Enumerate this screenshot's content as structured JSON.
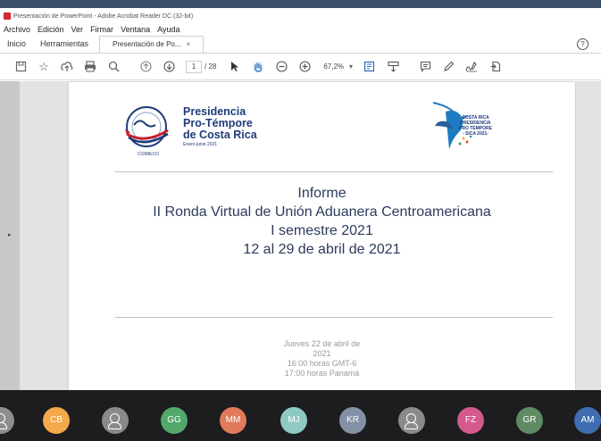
{
  "window": {
    "title": "Presentación de PowerPoint - Adobe Acrobat Reader DC (32-bit)"
  },
  "menu": [
    "Archivo",
    "Edición",
    "Ver",
    "Firmar",
    "Ventana",
    "Ayuda"
  ],
  "tabs": {
    "home": "Inicio",
    "tools": "Herramientas",
    "document": "Presentación de Po...",
    "close": "×"
  },
  "help": "?",
  "toolbar": {
    "page_current": "1",
    "page_total": "/ 28",
    "zoom": "67,2%",
    "dropdown": "▾"
  },
  "document": {
    "logo_left_lines": [
      "Presidencia",
      "Pro-Témpore",
      "de Costa Rica"
    ],
    "logo_left_sub": "Enero-junio 2021",
    "logo_left_badge": "COMIECO",
    "logo_right_lines": [
      "COSTA RICA",
      "PRESIDENCIA",
      "PRO TEMPORE",
      "- SICA 2021-"
    ],
    "title_lines": [
      "Informe",
      "II Ronda Virtual de Unión Aduanera Centroamericana",
      "I semestre 2021",
      "12 al 29 de abril de 2021"
    ],
    "meta_lines": [
      "Jueves 22 de abril de",
      "2021",
      "16:00 horas GMT-6",
      "17:00 horas Panamá"
    ]
  },
  "participants": [
    {
      "initials": "",
      "color": "#8e8e8e",
      "generic": true
    },
    {
      "initials": "CB",
      "color": "#f4a94a"
    },
    {
      "initials": "",
      "color": "#8a8a8a",
      "generic": true
    },
    {
      "initials": "GG",
      "color": "#51a86a"
    },
    {
      "initials": "MM",
      "color": "#e07a5a"
    },
    {
      "initials": "MJ",
      "color": "#8fc9c3"
    },
    {
      "initials": "KR",
      "color": "#8391a6"
    },
    {
      "initials": "",
      "color": "#8a8a8a",
      "generic": true
    },
    {
      "initials": "FZ",
      "color": "#d45a8c"
    },
    {
      "initials": "GR",
      "color": "#5f8a64"
    },
    {
      "initials": "AM",
      "color": "#3f6db0"
    }
  ]
}
